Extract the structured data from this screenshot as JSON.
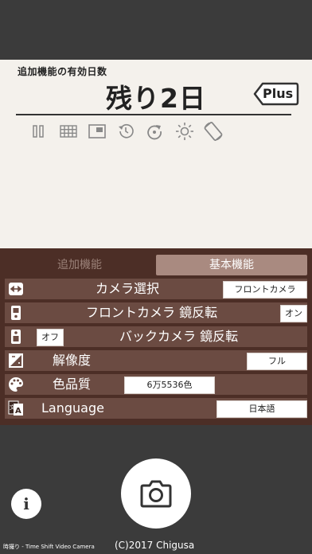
{
  "status_panel": {
    "feature_title": "追加機能の有効日数",
    "days_left": "残り2日",
    "plus_label": "Plus"
  },
  "feature_icons": [
    {
      "icon": "pause-icon"
    },
    {
      "icon": "grid-icon"
    },
    {
      "icon": "picture-in-picture-icon"
    },
    {
      "icon": "history-icon"
    },
    {
      "icon": "replay-icon"
    },
    {
      "icon": "brightness-icon"
    },
    {
      "icon": "screen-rotation-icon"
    }
  ],
  "tabs": {
    "additional": "追加機能",
    "basic": "基本機能"
  },
  "settings": {
    "camera_select": {
      "label": "カメラ選択",
      "value": "フロントカメラ",
      "icon": "camera-switch-icon"
    },
    "front_mirror": {
      "label": "フロントカメラ 鏡反転",
      "value": "オン",
      "icon": "front-camera-icon"
    },
    "back_mirror": {
      "label": "バックカメラ 鏡反転",
      "value": "オフ",
      "icon": "back-camera-icon"
    },
    "resolution": {
      "label": "解像度",
      "value": "フル",
      "icon": "resolution-icon"
    },
    "color_quality": {
      "label": "色品質",
      "value": "6万5536色",
      "icon": "palette-icon"
    },
    "language": {
      "label": "Language",
      "value": "日本語",
      "icon": "translate-icon"
    }
  },
  "footer": {
    "app_name": "時撮り - Time Shift Video Camera",
    "copyright": "(C)2017 Chigusa"
  },
  "colors": {
    "panel_bg": "#f4f1ec",
    "settings_bg": "#4c2e26",
    "row_bg": "#6b4b42",
    "tab_active": "#a98a80",
    "dark_bg": "#3b3b3b"
  }
}
